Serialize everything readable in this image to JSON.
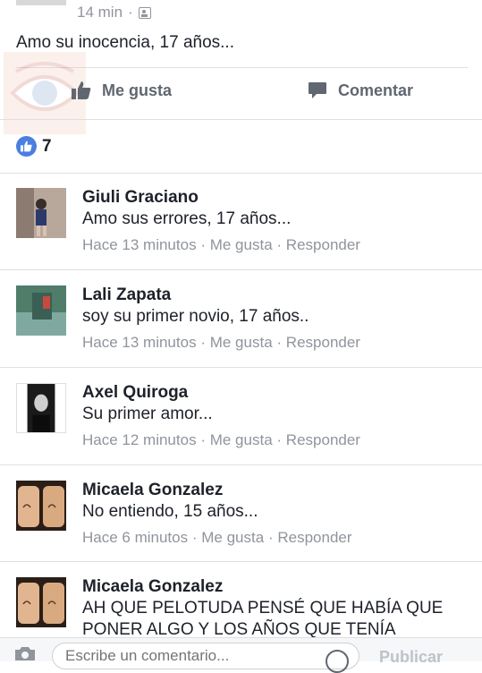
{
  "post": {
    "time": "14 min",
    "dot": "·",
    "text": "Amo su inocencia, 17 años...",
    "like_label": "Me gusta",
    "comment_label": "Comentar",
    "like_count": "7"
  },
  "comments": [
    {
      "name": "Giuli Graciano",
      "text": "Amo sus errores, 17 años...",
      "time": "Hace 13 minutos",
      "like": "Me gusta",
      "reply": "Responder",
      "sep": "·"
    },
    {
      "name": "Lali Zapata",
      "text": "soy su primer novio, 17 años..",
      "time": "Hace 13 minutos",
      "like": "Me gusta",
      "reply": "Responder",
      "sep": "·"
    },
    {
      "name": "Axel Quiroga",
      "text": "Su primer amor...",
      "time": "Hace 12 minutos",
      "like": "Me gusta",
      "reply": "Responder",
      "sep": "·"
    },
    {
      "name": "Micaela Gonzalez",
      "text": "No entiendo, 15 años...",
      "time": "Hace 6 minutos",
      "like": "Me gusta",
      "reply": "Responder",
      "sep": "·"
    },
    {
      "name": "Micaela Gonzalez",
      "text_line1": "AH QUE PELOTUDA PENSÉ QUE HABÍA QUE",
      "text_line2": "PONER ALGO Y LOS AÑOS QUE TENÍA"
    }
  ],
  "composer": {
    "placeholder": "Escribe un comentario...",
    "publish_label": "Publicar"
  },
  "colors": {
    "like_blue": "#4a7fe0",
    "meta_gray": "#90949c",
    "action_gray": "#606770"
  },
  "icons": [
    "audience-icon",
    "thumbs-up-icon",
    "comment-bubble-icon",
    "camera-icon",
    "emoji-icon"
  ]
}
